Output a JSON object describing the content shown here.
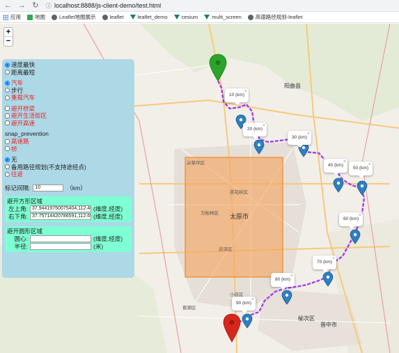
{
  "browser": {
    "url": "localhost:8888/js-client-demo/test.html",
    "bookmarks": [
      "应用",
      "地图",
      "Leaflet地图展示",
      "leaflet",
      "leaflet_demo",
      "cesium",
      "multi_screen",
      "高德路径规划-leaflet"
    ]
  },
  "zoom": {
    "in_label": "+",
    "out_label": "−"
  },
  "panel": {
    "route_strategy": [
      "速度最快",
      "距离最短"
    ],
    "vehicle": [
      "汽车",
      "步行",
      "重载汽车"
    ],
    "avoid": [
      "避开桥梁",
      "避开生活街区",
      "避开高速"
    ],
    "snap_title": "snap_prevention",
    "snap_options": [
      "高速路",
      "桥"
    ],
    "mode": [
      "无",
      "备用路径规划(不支持途经点)",
      "往返"
    ],
    "interval_label": "标记间隔:",
    "interval_value": "10",
    "interval_unit": "（km）",
    "rect": {
      "title": "避开方形区域",
      "top_left_label": "左上角:",
      "top_left_value": "37.94419750075404,112.46",
      "bottom_right_label": "右下角:",
      "bottom_right_value": "37.75714420786591,112.65",
      "unit": "(维度,经度)"
    },
    "circle": {
      "title": "避开圆形区域",
      "center_label": "圆心:",
      "center_value": "",
      "center_unit": "(维度,经度)",
      "radius_label": "半径:",
      "radius_value": "",
      "radius_unit": "(米)"
    }
  },
  "markers": [
    "10 (km)",
    "20 (km)",
    "30 (km)",
    "40 (km)",
    "50 (km)",
    "60 (km)",
    "70 (km)",
    "80 (km)",
    "90 (km)"
  ],
  "map_labels": [
    "阳曲县",
    "太原市",
    "杏花岭区",
    "万柏林区",
    "小店区",
    "晋源区",
    "榆次区",
    "晋中市",
    "尖草坪区",
    "迎泽区"
  ],
  "colors": {
    "route": "#a040e8",
    "rect_fill": "#f5a15a",
    "rect_stroke": "#f08a24",
    "pin_blue": "#2f7fbf",
    "pin_green": "#2aa52a",
    "pin_red": "#d9261c"
  }
}
